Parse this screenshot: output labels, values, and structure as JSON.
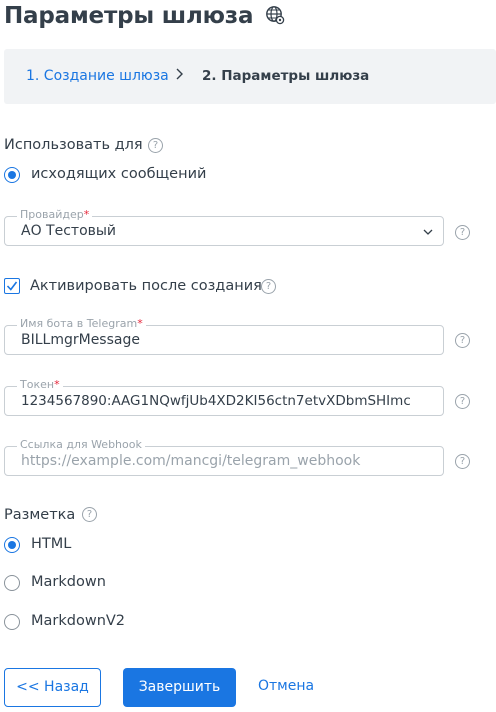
{
  "page": {
    "title": "Параметры шлюза",
    "title_icon": "globe-settings-icon"
  },
  "breadcrumb": {
    "step1": "1. Создание шлюза",
    "separator_icon": "chevron-right-icon",
    "step2": "2. Параметры шлюза"
  },
  "use_for": {
    "label": "Использовать для",
    "help": "?",
    "option": "исходящих сообщений",
    "selected": true
  },
  "provider": {
    "legend": "Провайдер",
    "required_mark": "*",
    "value": "АО Тестовый",
    "help": "?"
  },
  "activate": {
    "label": "Активировать после создания",
    "checked": true,
    "help": "?"
  },
  "bot_name": {
    "legend": "Имя бота в Telegram",
    "required_mark": "*",
    "value": "BILLmgrMessage",
    "help": "?"
  },
  "token": {
    "legend": "Токен",
    "required_mark": "*",
    "value": "1234567890:AAG1NQwfjUb4XD2KI56ctn7etvXDbmSHImc",
    "help": "?"
  },
  "webhook": {
    "legend": "Ссылка для Webhook",
    "placeholder": "https://example.com/mancgi/telegram_webhook",
    "help": "?"
  },
  "markup": {
    "label": "Разметка",
    "help": "?",
    "options": [
      "HTML",
      "Markdown",
      "MarkdownV2"
    ],
    "selected": "HTML"
  },
  "actions": {
    "back": "<< Назад",
    "finish": "Завершить",
    "cancel": "Отмена"
  },
  "colors": {
    "accent": "#1a76e2",
    "required": "#e5263b",
    "breadcrumb_bg": "#f1f3f5"
  }
}
